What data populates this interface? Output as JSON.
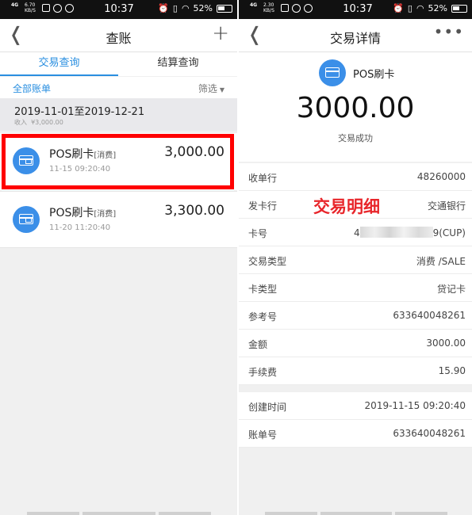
{
  "status_bar": {
    "network": "4G",
    "speed_left": "6.70",
    "speed_right": "2.30",
    "speed_unit": "KB/S",
    "time": "10:37",
    "battery": "52%"
  },
  "list_screen": {
    "title": "查账",
    "back_icon": "chevron-left-icon",
    "add_icon": "plus-icon",
    "tabs": [
      "交易查询",
      "结算查询"
    ],
    "active_tab": 0,
    "all_bills": "全部账单",
    "filter": "筛选",
    "date_range": "2019-11-01至2019-12-21",
    "income_label": "收入",
    "income_value": "¥3,000.00",
    "transactions": [
      {
        "name": "POS刷卡",
        "tag": "[消费]",
        "time": "11-15 09:20:40",
        "amount": "3,000.00",
        "icon": "card-icon",
        "highlighted": true
      },
      {
        "name": "POS刷卡",
        "tag": "[消费]",
        "time": "11-20 11:20:40",
        "amount": "3,300.00",
        "icon": "card-icon",
        "highlighted": false
      }
    ]
  },
  "detail_screen": {
    "title": "交易详情",
    "more_icon": "more-icon",
    "name": "POS刷卡",
    "amount": "3000.00",
    "status": "交易成功",
    "annotation": "交易明细",
    "rows": [
      {
        "label": "收单行",
        "value": "48260000"
      },
      {
        "label": "发卡行",
        "value": "交通银行"
      },
      {
        "label": "卡号",
        "value_start": "4",
        "value_end": "9(CUP)"
      },
      {
        "label": "交易类型",
        "value": "消费 /SALE"
      },
      {
        "label": "卡类型",
        "value": "贷记卡"
      },
      {
        "label": "参考号",
        "value": "633640048261"
      },
      {
        "label": "金额",
        "value": "3000.00"
      },
      {
        "label": "手续费",
        "value": "15.90"
      }
    ],
    "rows2": [
      {
        "label": "创建时间",
        "value": "2019-11-15 09:20:40"
      },
      {
        "label": "账单号",
        "value": "633640048261"
      }
    ]
  },
  "colors": {
    "accent": "#2a8fe0",
    "icon_blue": "#3b8fe8",
    "highlight_red": "#ff0000",
    "annotation_red": "#e8262b"
  }
}
